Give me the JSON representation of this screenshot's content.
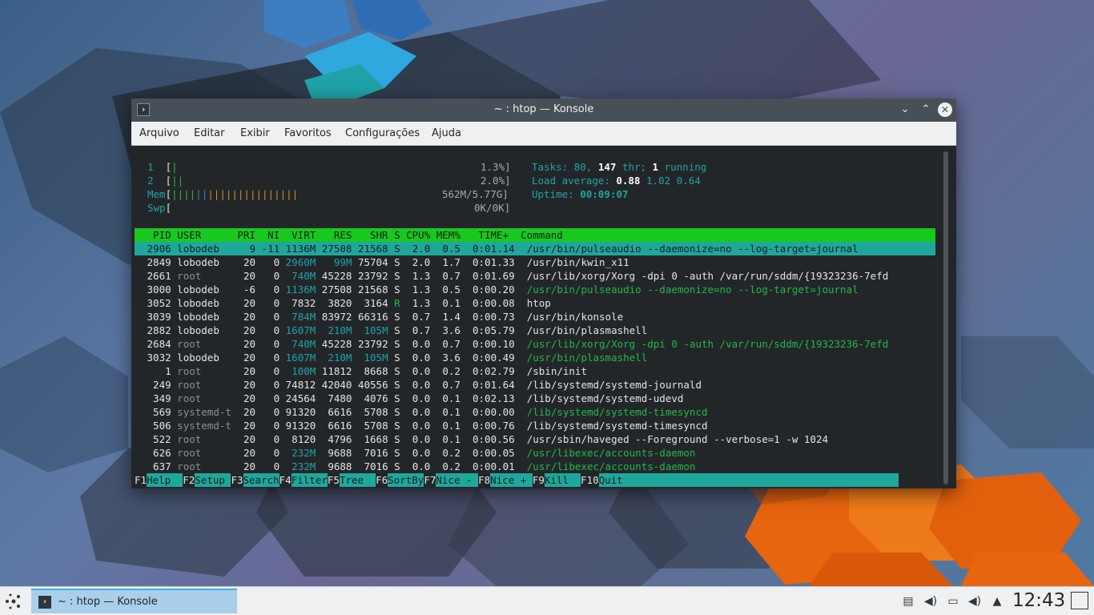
{
  "window": {
    "title": "~ : htop — Konsole",
    "menu": [
      "Arquivo",
      "Editar",
      "Exibir",
      "Favoritos",
      "Configurações",
      "Ajuda"
    ]
  },
  "htop": {
    "cpu1": {
      "num": "1",
      "bar": "|",
      "pct": "1.3%]"
    },
    "cpu2": {
      "num": "2",
      "bar": "||",
      "pct": "2.0%]"
    },
    "mem": {
      "label": "Mem",
      "bar_g": "||||",
      "bar_b": "||",
      "bar_o": "|||||||||||||||",
      "value": "562M/5.77G]"
    },
    "swp": {
      "label": "Swp",
      "value": "0K/0K]"
    },
    "tasks": {
      "label": "Tasks: ",
      "count": "80",
      "sep1": ", ",
      "thr": "147",
      "thr_label": " thr; ",
      "running": "1",
      "running_label": " running"
    },
    "load": {
      "label": "Load average: ",
      "v1": "0.88",
      "v2": "1.02",
      "v3": "0.64"
    },
    "uptime": {
      "label": "Uptime: ",
      "value": "00:09:07"
    },
    "header": "  PID USER      PRI  NI  VIRT   RES   SHR S CPU% MEM%   TIME+  Command",
    "processes": [
      {
        "pid": "2906",
        "user": "lobodeb",
        "pri": "9",
        "ni": "-11",
        "virt": "1136M",
        "res": "27508",
        "shr": "21568",
        "s": "S",
        "cpu": "2.0",
        "mem": "0.5",
        "time": "0:01.14",
        "cmd": "/usr/bin/pulseaudio --daemonize=no --log-target=journal"
      },
      {
        "pid": "2849",
        "user": "lobodeb",
        "pri": "20",
        "ni": "0",
        "virt": "2960M",
        "res": "99M",
        "shr": "75704",
        "s": "S",
        "cpu": "2.0",
        "mem": "1.7",
        "time": "0:01.33",
        "cmd": "/usr/bin/kwin_x11"
      },
      {
        "pid": "2661",
        "user": "root",
        "pri": "20",
        "ni": "0",
        "virt": "740M",
        "res": "45228",
        "shr": "23792",
        "s": "S",
        "cpu": "1.3",
        "mem": "0.7",
        "time": "0:01.69",
        "cmd": "/usr/lib/xorg/Xorg -dpi 0 -auth /var/run/sddm/{19323236-7efd"
      },
      {
        "pid": "3000",
        "user": "lobodeb",
        "pri": "-6",
        "ni": "0",
        "virt": "1136M",
        "res": "27508",
        "shr": "21568",
        "s": "S",
        "cpu": "1.3",
        "mem": "0.5",
        "time": "0:00.20",
        "cmd": "/usr/bin/pulseaudio --daemonize=no --log-target=journal"
      },
      {
        "pid": "3052",
        "user": "lobodeb",
        "pri": "20",
        "ni": "0",
        "virt": "7832",
        "res": "3820",
        "shr": "3164",
        "s": "R",
        "cpu": "1.3",
        "mem": "0.1",
        "time": "0:00.08",
        "cmd": "htop"
      },
      {
        "pid": "3039",
        "user": "lobodeb",
        "pri": "20",
        "ni": "0",
        "virt": "784M",
        "res": "83972",
        "shr": "66316",
        "s": "S",
        "cpu": "0.7",
        "mem": "1.4",
        "time": "0:00.73",
        "cmd": "/usr/bin/konsole"
      },
      {
        "pid": "2882",
        "user": "lobodeb",
        "pri": "20",
        "ni": "0",
        "virt": "1607M",
        "res": "210M",
        "shr": "105M",
        "s": "S",
        "cpu": "0.7",
        "mem": "3.6",
        "time": "0:05.79",
        "cmd": "/usr/bin/plasmashell"
      },
      {
        "pid": "2684",
        "user": "root",
        "pri": "20",
        "ni": "0",
        "virt": "740M",
        "res": "45228",
        "shr": "23792",
        "s": "S",
        "cpu": "0.0",
        "mem": "0.7",
        "time": "0:00.10",
        "cmd": "/usr/lib/xorg/Xorg -dpi 0 -auth /var/run/sddm/{19323236-7efd"
      },
      {
        "pid": "3032",
        "user": "lobodeb",
        "pri": "20",
        "ni": "0",
        "virt": "1607M",
        "res": "210M",
        "shr": "105M",
        "s": "S",
        "cpu": "0.0",
        "mem": "3.6",
        "time": "0:00.49",
        "cmd": "/usr/bin/plasmashell"
      },
      {
        "pid": "1",
        "user": "root",
        "pri": "20",
        "ni": "0",
        "virt": "100M",
        "res": "11812",
        "shr": "8668",
        "s": "S",
        "cpu": "0.0",
        "mem": "0.2",
        "time": "0:02.79",
        "cmd": "/sbin/init"
      },
      {
        "pid": "249",
        "user": "root",
        "pri": "20",
        "ni": "0",
        "virt": "74812",
        "res": "42040",
        "shr": "40556",
        "s": "S",
        "cpu": "0.0",
        "mem": "0.7",
        "time": "0:01.64",
        "cmd": "/lib/systemd/systemd-journald"
      },
      {
        "pid": "349",
        "user": "root",
        "pri": "20",
        "ni": "0",
        "virt": "24564",
        "res": "7480",
        "shr": "4076",
        "s": "S",
        "cpu": "0.0",
        "mem": "0.1",
        "time": "0:02.13",
        "cmd": "/lib/systemd/systemd-udevd"
      },
      {
        "pid": "569",
        "user": "systemd-t",
        "pri": "20",
        "ni": "0",
        "virt": "91320",
        "res": "6616",
        "shr": "5708",
        "s": "S",
        "cpu": "0.0",
        "mem": "0.1",
        "time": "0:00.00",
        "cmd": "/lib/systemd/systemd-timesyncd"
      },
      {
        "pid": "506",
        "user": "systemd-t",
        "pri": "20",
        "ni": "0",
        "virt": "91320",
        "res": "6616",
        "shr": "5708",
        "s": "S",
        "cpu": "0.0",
        "mem": "0.1",
        "time": "0:00.76",
        "cmd": "/lib/systemd/systemd-timesyncd"
      },
      {
        "pid": "522",
        "user": "root",
        "pri": "20",
        "ni": "0",
        "virt": "8120",
        "res": "4796",
        "shr": "1668",
        "s": "S",
        "cpu": "0.0",
        "mem": "0.1",
        "time": "0:00.56",
        "cmd": "/usr/sbin/haveged --Foreground --verbose=1 -w 1024"
      },
      {
        "pid": "626",
        "user": "root",
        "pri": "20",
        "ni": "0",
        "virt": "232M",
        "res": "9688",
        "shr": "7016",
        "s": "S",
        "cpu": "0.0",
        "mem": "0.2",
        "time": "0:00.05",
        "cmd": "/usr/libexec/accounts-daemon"
      },
      {
        "pid": "637",
        "user": "root",
        "pri": "20",
        "ni": "0",
        "virt": "232M",
        "res": "9688",
        "shr": "7016",
        "s": "S",
        "cpu": "0.0",
        "mem": "0.2",
        "time": "0:00.01",
        "cmd": "/usr/libexec/accounts-daemon"
      }
    ],
    "thread_rows": [
      3,
      7,
      8,
      12,
      15,
      16
    ],
    "selected_row": 0,
    "fkeys": [
      {
        "key": "F1",
        "label": "Help  "
      },
      {
        "key": "F2",
        "label": "Setup "
      },
      {
        "key": "F3",
        "label": "Search"
      },
      {
        "key": "F4",
        "label": "Filter"
      },
      {
        "key": "F5",
        "label": "Tree  "
      },
      {
        "key": "F6",
        "label": "SortBy"
      },
      {
        "key": "F7",
        "label": "Nice - "
      },
      {
        "key": "F8",
        "label": "Nice + "
      },
      {
        "key": "F9",
        "label": "Kill  "
      },
      {
        "key": "F10",
        "label": "Quit"
      }
    ]
  },
  "taskbar": {
    "task_label": "~ : htop — Konsole",
    "clock": "12:43",
    "tray_icons": [
      "clipboard-icon",
      "volume-icon",
      "network-icon",
      "speaker-icon",
      "expand-tray-icon"
    ]
  },
  "colors": {
    "titlebar": "#475057",
    "terminal_bg": "#232629",
    "header_green": "#18c81f",
    "selection_teal": "#1ea89c",
    "accent_blue": "#3daee9"
  }
}
